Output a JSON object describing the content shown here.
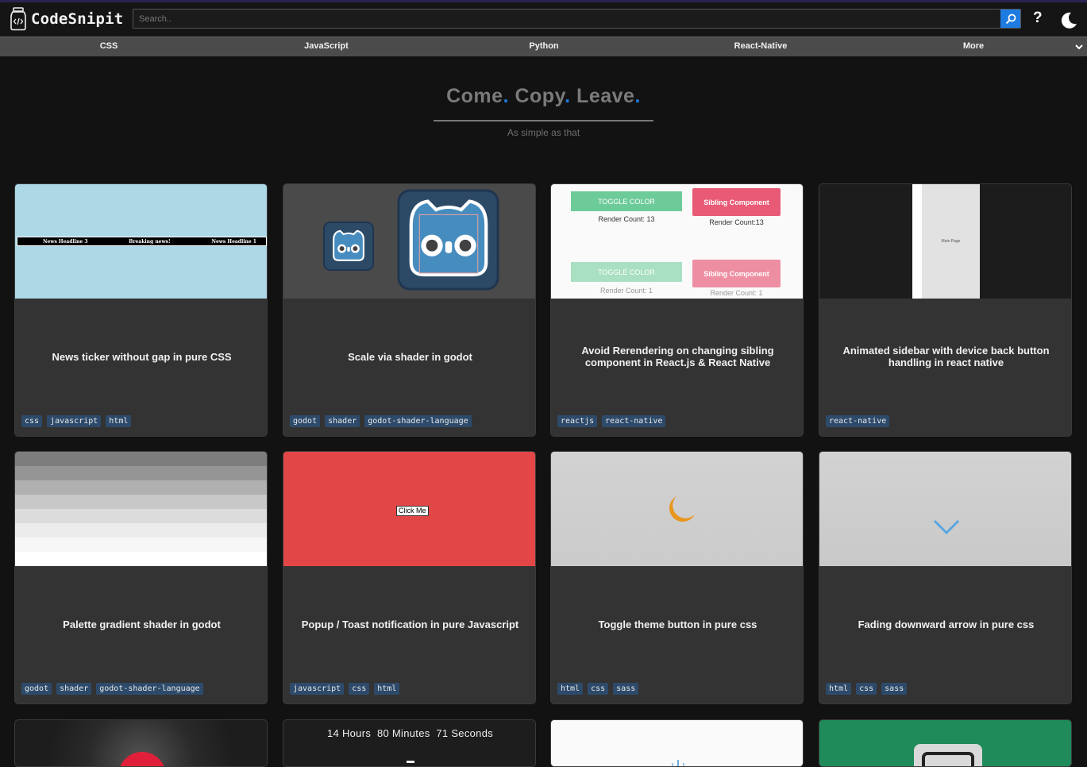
{
  "header": {
    "brand": "CodeSnipit",
    "search_placeholder": "Search..",
    "help_label": "?",
    "icons": {
      "logo": "code-jar-icon",
      "search": "search-icon",
      "theme": "moon-icon"
    },
    "accent_color": "#1e7be0"
  },
  "nav": {
    "items": [
      {
        "label": "CSS"
      },
      {
        "label": "JavaScript"
      },
      {
        "label": "Python"
      },
      {
        "label": "React-Native"
      },
      {
        "label": "More"
      }
    ]
  },
  "hero": {
    "word1": "Come",
    "word2": "Copy",
    "word3": "Leave",
    "dot": ".",
    "subtitle": "As simple as that"
  },
  "cards": [
    {
      "title": "News ticker without gap in pure CSS",
      "tags": [
        "css",
        "javascript",
        "html"
      ],
      "preview": {
        "ticker_1": "News Headline 3",
        "ticker_2": "Breaking news!",
        "ticker_3": "News Headline 1"
      }
    },
    {
      "title": "Scale via shader in godot",
      "tags": [
        "godot",
        "shader",
        "godot-shader-language"
      ],
      "preview": {
        "icon": "godot-logo-icon"
      }
    },
    {
      "title": "Avoid Rerendering on changing sibling component in React.js & React Native",
      "tags": [
        "reactjs",
        "react-native"
      ],
      "preview": {
        "toggle_label": "TOGGLE COLOR",
        "sibling_label": "Sibling Component",
        "render_count_a": "Render Count: 13",
        "render_count_b": "Render Count:13",
        "render_count_c": "Render Count: 1",
        "render_count_d": "Render Count: 1"
      }
    },
    {
      "title": "Animated sidebar with device back button handling in react native",
      "tags": [
        "react-native"
      ],
      "preview": {
        "page_label": "Main Page"
      }
    },
    {
      "title": "Palette gradient shader in godot",
      "tags": [
        "godot",
        "shader",
        "godot-shader-language"
      ],
      "preview": {
        "swatches": [
          "#7d7d7d",
          "#959595",
          "#b0b0b0",
          "#c8c8c8",
          "#dcdcdc",
          "#ececec",
          "#f7f7f7",
          "#ffffff"
        ]
      }
    },
    {
      "title": "Popup / Toast notification in pure Javascript",
      "tags": [
        "javascript",
        "css",
        "html"
      ],
      "preview": {
        "button_label": "Click Me",
        "bg_color": "#e34646"
      }
    },
    {
      "title": "Toggle theme button in pure css",
      "tags": [
        "html",
        "css",
        "sass"
      ],
      "preview": {
        "icon": "crescent-moon-icon",
        "icon_color": "#e8961e"
      }
    },
    {
      "title": "Fading downward arrow in pure css",
      "tags": [
        "html",
        "css",
        "sass"
      ],
      "preview": {
        "icon": "chevron-down-icon",
        "icon_color": "#5aa6e0"
      }
    }
  ],
  "partial_cards": [
    {
      "preview": {
        "icon": "red-circle-icon"
      }
    },
    {
      "preview": {
        "countdown": "14 Hours  80 Minutes  71 Seconds"
      }
    },
    {
      "preview": {
        "icon": "loader-icon"
      }
    },
    {
      "preview": {
        "icon": "image-icon",
        "bg_color": "#1f8a5a"
      }
    }
  ]
}
